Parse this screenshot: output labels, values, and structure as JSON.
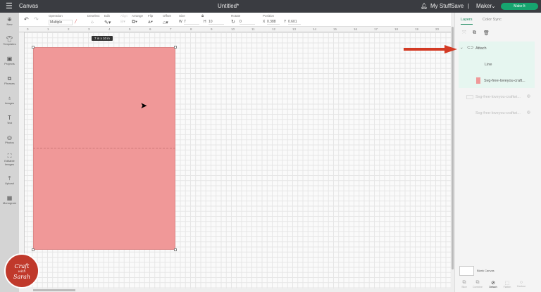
{
  "topbar": {
    "title": "Canvas",
    "doc": "Untitled*",
    "mystuff": "My Stuff",
    "save": "Save",
    "sep": "|",
    "machine": "Maker",
    "makeit": "Make It"
  },
  "toolbar": {
    "operation_label": "Operation",
    "operation_value": "Multiple",
    "deselect": "Deselect",
    "edit": "Edit",
    "align": "Align",
    "arrange": "Arrange",
    "flip": "Flip",
    "offset": "Offset",
    "size": "Size",
    "w_label": "W",
    "w": "7",
    "h_label": "H",
    "h": "10",
    "rotate": "Rotate",
    "rotate_value": "0",
    "position": "Position",
    "x_label": "X",
    "x": "0.388",
    "y_label": "Y",
    "y": "0.601"
  },
  "sidebar": [
    "New",
    "Templates",
    "Projects",
    "Phrases",
    "Images",
    "Text",
    "Photos",
    "Editable Images",
    "Upload",
    "Monogram"
  ],
  "ruler": [
    "0",
    "1",
    "2",
    "3",
    "4",
    "5",
    "6",
    "7",
    "8",
    "9",
    "10",
    "11",
    "12",
    "13",
    "14",
    "15",
    "16",
    "17",
    "18",
    "19",
    "20"
  ],
  "canvas": {
    "tooltip": "7 in x 10 in",
    "shape_color": "#f09898"
  },
  "panel": {
    "tabs": [
      "Layers",
      "Color Sync"
    ],
    "group": "Attach",
    "layers": [
      "Line",
      "Svg-free-loveyou-craft...",
      "Svg-free-loveyou-craftwi...",
      "Svg-free-loveyou-craftwi..."
    ],
    "blank": "Blank Canvas",
    "actions": [
      "Slice",
      "Combine",
      "Detach",
      "Flatten",
      "Contour"
    ]
  },
  "logo": {
    "line1": "Craft",
    "line2": "with",
    "line3": "Sarah"
  }
}
